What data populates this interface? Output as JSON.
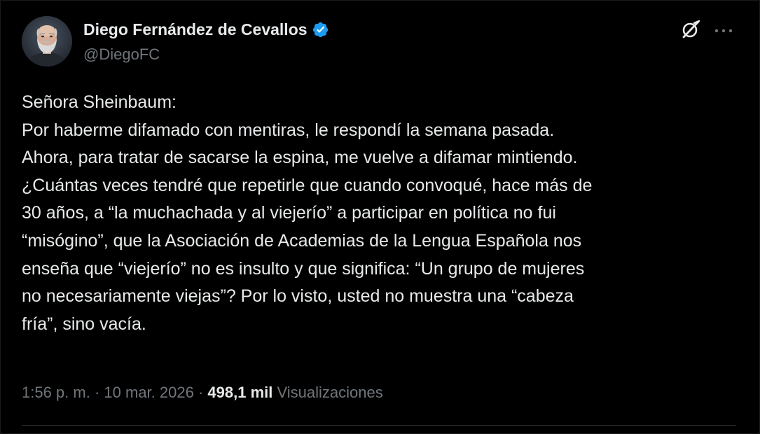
{
  "author": {
    "name": "Diego Fernández de Cevallos",
    "handle": "@DiegoFC",
    "verified": true,
    "verified_color": "#1d9bf0"
  },
  "header_actions": {
    "grok_icon": "grok-icon",
    "more_icon": "more-dots-icon"
  },
  "tweet": {
    "lines": [
      "Señora Sheinbaum:",
      "Por haberme difamado con mentiras, le respondí la semana pasada.",
      "Ahora, para tratar de sacarse la espina, me vuelve a difamar mintiendo.",
      "¿Cuántas veces tendré que repetirle que cuando convoqué, hace más de",
      "30 años, a “la muchachada y al viejerío” a participar en política no fui",
      "“misógino”, que la Asociación de Academias de la Lengua Española nos",
      "enseña que “viejerío” no es insulto y que significa: “Un grupo de mujeres",
      "no necesariamente viejas”? Por lo visto, usted no muestra una “cabeza",
      "fría”, sino vacía."
    ]
  },
  "meta": {
    "time": "1:56 p. m.",
    "separator": " · ",
    "date": "10 mar. 2026",
    "views_count": "498,1 mil",
    "views_label": "Visualizaciones"
  },
  "colors": {
    "background": "#000000",
    "text": "#e7e9ea",
    "secondary": "#71767b",
    "divider": "#2f3336"
  }
}
